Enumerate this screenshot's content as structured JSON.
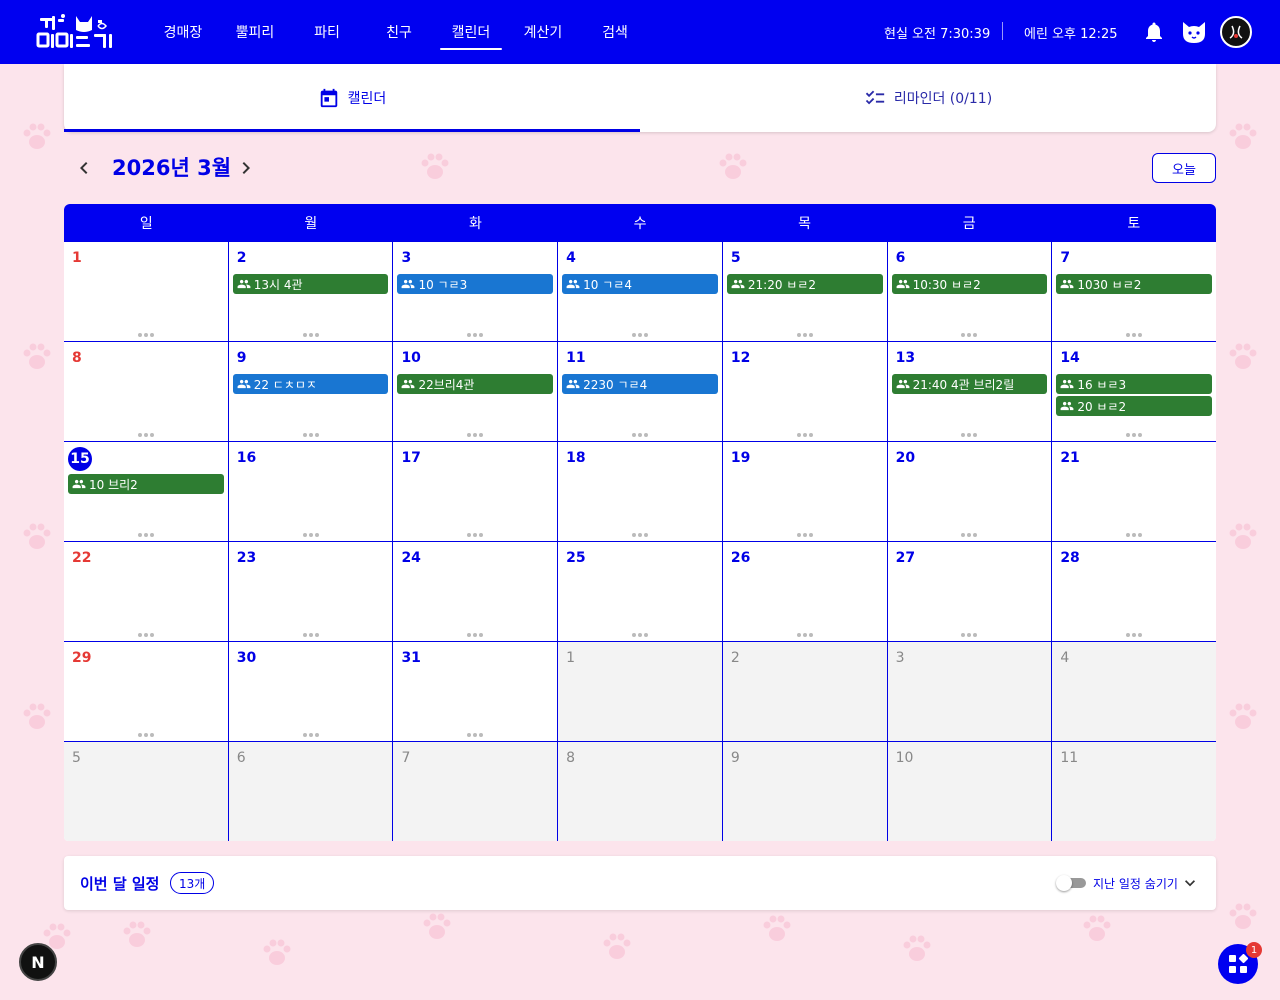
{
  "header": {
    "logo_alt": "",
    "nav": [
      {
        "label": "경매장"
      },
      {
        "label": "뿔피리"
      },
      {
        "label": "파티"
      },
      {
        "label": "친구"
      },
      {
        "label": "캘린더"
      },
      {
        "label": "계산기"
      },
      {
        "label": "검색"
      }
    ],
    "active_nav": "캘린더",
    "real_time": "현실 오전 7:30:39",
    "erin_time": "에린 오후 12:25"
  },
  "tabs": {
    "calendar_label": "캘린더",
    "reminder_label": "리마인더 (0/11)"
  },
  "month_nav": {
    "title": "2026년 3월",
    "today_label": "오늘"
  },
  "calendar": {
    "weekdays": [
      "일",
      "월",
      "화",
      "수",
      "목",
      "금",
      "토"
    ],
    "weeks": [
      {
        "days": [
          {
            "num": "1",
            "type": "sun",
            "events": []
          },
          {
            "num": "2",
            "events": [
              {
                "text": "13시 4관",
                "color": "green"
              }
            ]
          },
          {
            "num": "3",
            "events": [
              {
                "text": "10 ㄱㄹ3",
                "color": "blue"
              }
            ]
          },
          {
            "num": "4",
            "events": [
              {
                "text": "10 ㄱㄹ4",
                "color": "blue"
              }
            ]
          },
          {
            "num": "5",
            "events": [
              {
                "text": "21:20 ㅂㄹ2",
                "color": "green"
              }
            ]
          },
          {
            "num": "6",
            "events": [
              {
                "text": "10:30 ㅂㄹ2",
                "color": "green"
              }
            ]
          },
          {
            "num": "7",
            "events": [
              {
                "text": "1030 ㅂㄹ2",
                "color": "green"
              }
            ]
          }
        ]
      },
      {
        "days": [
          {
            "num": "8",
            "type": "sun",
            "events": []
          },
          {
            "num": "9",
            "events": [
              {
                "text": "22 ㄷㅊㅁㅈ",
                "color": "blue"
              }
            ]
          },
          {
            "num": "10",
            "events": [
              {
                "text": "22브리4관",
                "color": "green"
              }
            ]
          },
          {
            "num": "11",
            "events": [
              {
                "text": "2230 ㄱㄹ4",
                "color": "blue"
              }
            ]
          },
          {
            "num": "12",
            "events": []
          },
          {
            "num": "13",
            "events": [
              {
                "text": "21:40 4관 브리2릴",
                "color": "green"
              }
            ]
          },
          {
            "num": "14",
            "events": [
              {
                "text": "16 ㅂㄹ3",
                "color": "green"
              },
              {
                "text": "20 ㅂㄹ2",
                "color": "green"
              }
            ]
          }
        ]
      },
      {
        "days": [
          {
            "num": "15",
            "type": "today",
            "events": [
              {
                "text": "10 브리2",
                "color": "green"
              }
            ]
          },
          {
            "num": "16",
            "events": []
          },
          {
            "num": "17",
            "events": []
          },
          {
            "num": "18",
            "events": []
          },
          {
            "num": "19",
            "events": []
          },
          {
            "num": "20",
            "events": []
          },
          {
            "num": "21",
            "events": []
          }
        ]
      },
      {
        "days": [
          {
            "num": "22",
            "type": "sun",
            "events": []
          },
          {
            "num": "23",
            "events": []
          },
          {
            "num": "24",
            "events": []
          },
          {
            "num": "25",
            "events": []
          },
          {
            "num": "26",
            "events": []
          },
          {
            "num": "27",
            "events": []
          },
          {
            "num": "28",
            "events": []
          }
        ]
      },
      {
        "days": [
          {
            "num": "29",
            "type": "sun",
            "events": []
          },
          {
            "num": "30",
            "events": []
          },
          {
            "num": "31",
            "events": []
          },
          {
            "num": "1",
            "type": "other",
            "events": []
          },
          {
            "num": "2",
            "type": "other",
            "events": []
          },
          {
            "num": "3",
            "type": "other",
            "events": []
          },
          {
            "num": "4",
            "type": "other",
            "events": []
          }
        ]
      },
      {
        "days": [
          {
            "num": "5",
            "type": "other",
            "events": []
          },
          {
            "num": "6",
            "type": "other",
            "events": []
          },
          {
            "num": "7",
            "type": "other",
            "events": []
          },
          {
            "num": "8",
            "type": "other",
            "events": []
          },
          {
            "num": "9",
            "type": "other",
            "events": []
          },
          {
            "num": "10",
            "type": "other",
            "events": []
          },
          {
            "num": "11",
            "type": "other",
            "events": []
          }
        ]
      }
    ]
  },
  "summary": {
    "title": "이번 달 일정",
    "count": "13개",
    "toggle_label": "지난 일정 숨기기"
  },
  "floating": {
    "n_label": "N",
    "badge_count": "1"
  },
  "colors": {
    "primary": "#0000f0",
    "event_green": "#2e7d32",
    "event_blue": "#1976d2",
    "sunday": "#e53935",
    "background": "#fce4ec"
  }
}
